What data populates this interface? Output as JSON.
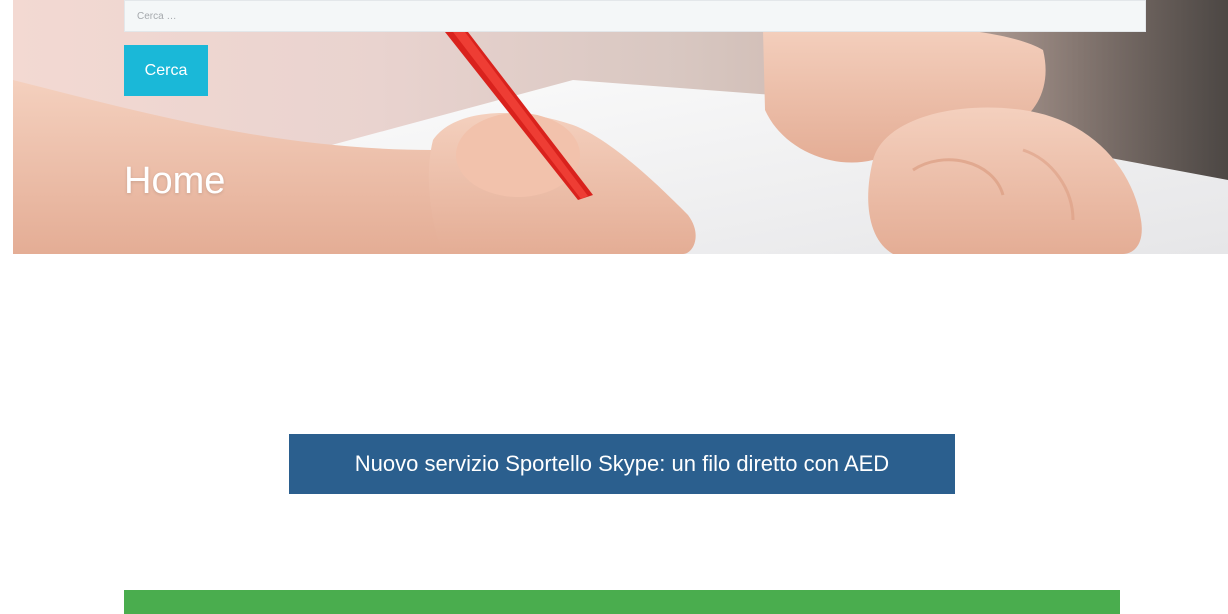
{
  "search": {
    "placeholder": "Cerca …",
    "button_label": "Cerca"
  },
  "hero": {
    "title": "Home"
  },
  "news_banner": {
    "label": "Nuovo servizio Sportello Skype: un filo diretto con AED"
  },
  "colors": {
    "search_button": "#1ab8d8",
    "news_banner": "#2b5f8e",
    "green_bar": "#4aad4e"
  }
}
